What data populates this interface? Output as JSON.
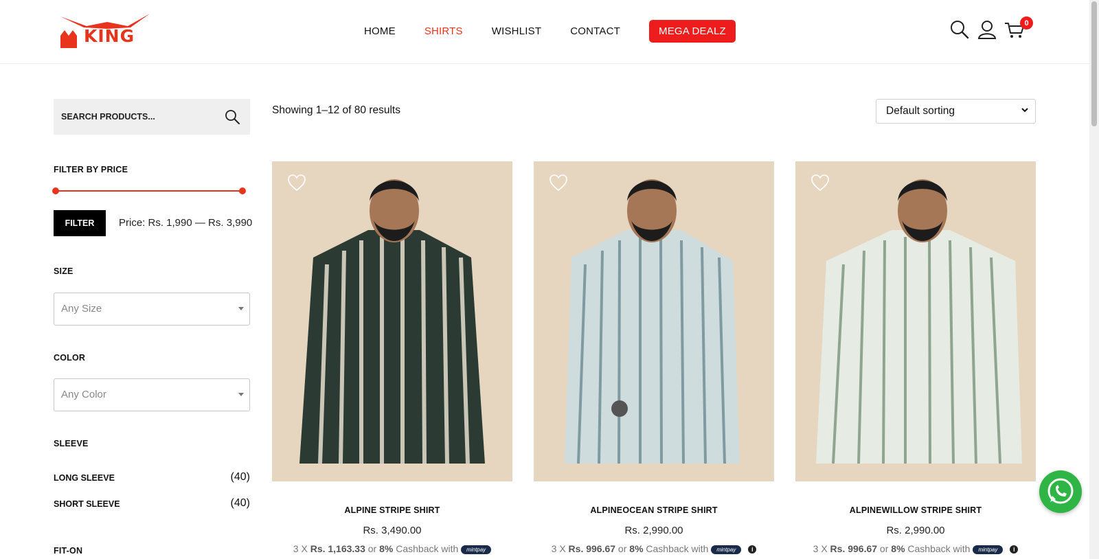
{
  "brand": {
    "logo_text": "KING",
    "accent": "#e8341c"
  },
  "nav": {
    "items": [
      {
        "label": "HOME",
        "active": false
      },
      {
        "label": "SHIRTS",
        "active": true
      },
      {
        "label": "WISHLIST",
        "active": false
      },
      {
        "label": "CONTACT",
        "active": false
      }
    ],
    "deal_label": "MEGA DEALZ",
    "deal_color": "#ee1c1c"
  },
  "header_icons": {
    "search": "search-icon",
    "account": "user-icon",
    "cart": "cart-icon",
    "cart_count": "0"
  },
  "sidebar": {
    "search_placeholder": "SEARCH PRODUCTS...",
    "price_title": "FILTER BY PRICE",
    "filter_label": "FILTER",
    "price_range": "Price: Rs. 1,990 — Rs. 3,990",
    "size_title": "SIZE",
    "size_value": "Any Size",
    "color_title": "COLOR",
    "color_value": "Any Color",
    "sleeve_title": "SLEEVE",
    "sleeves": [
      {
        "label": "LONG SLEEVE",
        "count": "(40)"
      },
      {
        "label": "SHORT SLEEVE",
        "count": "(40)"
      }
    ],
    "fit_title": "FIT-ON"
  },
  "shop": {
    "results": "Showing 1–12 of 80 results",
    "sorting": "Default sorting"
  },
  "products": [
    {
      "name": "ALPINE STRIPE SHIRT",
      "price": "Rs. 3,490.00",
      "inst_prefix": "3 X ",
      "inst_amount": "Rs. 1,163.33",
      "inst_or": " or ",
      "cashback": "8%",
      "inst_suffix": " Cashback with ",
      "mint": "mintpay",
      "shirt_color": "#2b3b33",
      "stripe_color": "#c9c6b8",
      "info": false
    },
    {
      "name": "ALPINEOCEAN STRIPE SHIRT",
      "price": "Rs. 2,990.00",
      "inst_prefix": "3 X ",
      "inst_amount": "Rs. 996.67",
      "inst_or": " or ",
      "cashback": "8%",
      "inst_suffix": " Cashback with ",
      "mint": "mintpay",
      "shirt_color": "#cfdcde",
      "stripe_color": "#7f9aa0",
      "info": true
    },
    {
      "name": "ALPINEWILLOW STRIPE SHIRT",
      "price": "Rs. 2,990.00",
      "inst_prefix": "3 X ",
      "inst_amount": "Rs. 996.67",
      "inst_or": " or ",
      "cashback": "8%",
      "inst_suffix": " Cashback with ",
      "mint": "mintpay",
      "shirt_color": "#e6ebe4",
      "stripe_color": "#8fa590",
      "info": true
    }
  ]
}
